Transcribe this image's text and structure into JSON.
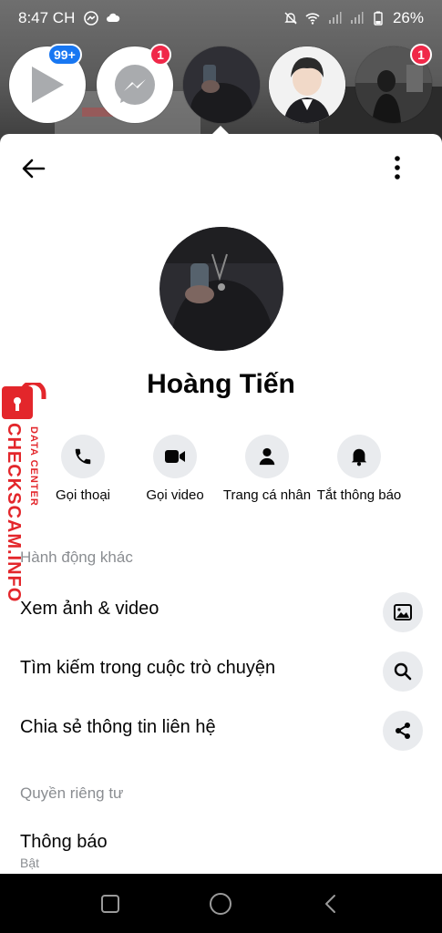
{
  "status_bar": {
    "time": "8:47 CH",
    "battery": "26%"
  },
  "chat_heads": [
    {
      "name": "video-app-head",
      "badge": "99+"
    },
    {
      "name": "messenger-head",
      "badge": "1"
    },
    {
      "name": "hoang-tien-head",
      "badge": ""
    },
    {
      "name": "anime-boy-head",
      "badge": ""
    },
    {
      "name": "dark-room-head",
      "badge": "1"
    }
  ],
  "profile": {
    "name": "Hoàng Tiến"
  },
  "actions": [
    {
      "label": "Gọi thoại",
      "icon": "phone-icon"
    },
    {
      "label": "Gọi video",
      "icon": "video-camera-icon"
    },
    {
      "label": "Trang cá nhân",
      "icon": "person-icon"
    },
    {
      "label": "Tắt thông báo",
      "icon": "bell-icon"
    }
  ],
  "sections": {
    "more_actions": "Hành động khác",
    "privacy": "Quyền riêng tư"
  },
  "more_actions_items": [
    {
      "label": "Xem ảnh & video",
      "icon": "image-icon"
    },
    {
      "label": "Tìm kiếm trong cuộc trò chuyện",
      "icon": "search-icon"
    },
    {
      "label": "Chia sẻ thông tin liên hệ",
      "icon": "share-icon"
    }
  ],
  "privacy_items": [
    {
      "label": "Thông báo",
      "sub": "Bật"
    }
  ],
  "watermark": {
    "main": "CHECKSCAM.INFO",
    "sub": "DATA CENTER"
  },
  "colors": {
    "accent_red": "#e3262b",
    "badge_red": "#f02849",
    "badge_blue": "#1877f2",
    "icon_bg": "#e9ebee"
  }
}
